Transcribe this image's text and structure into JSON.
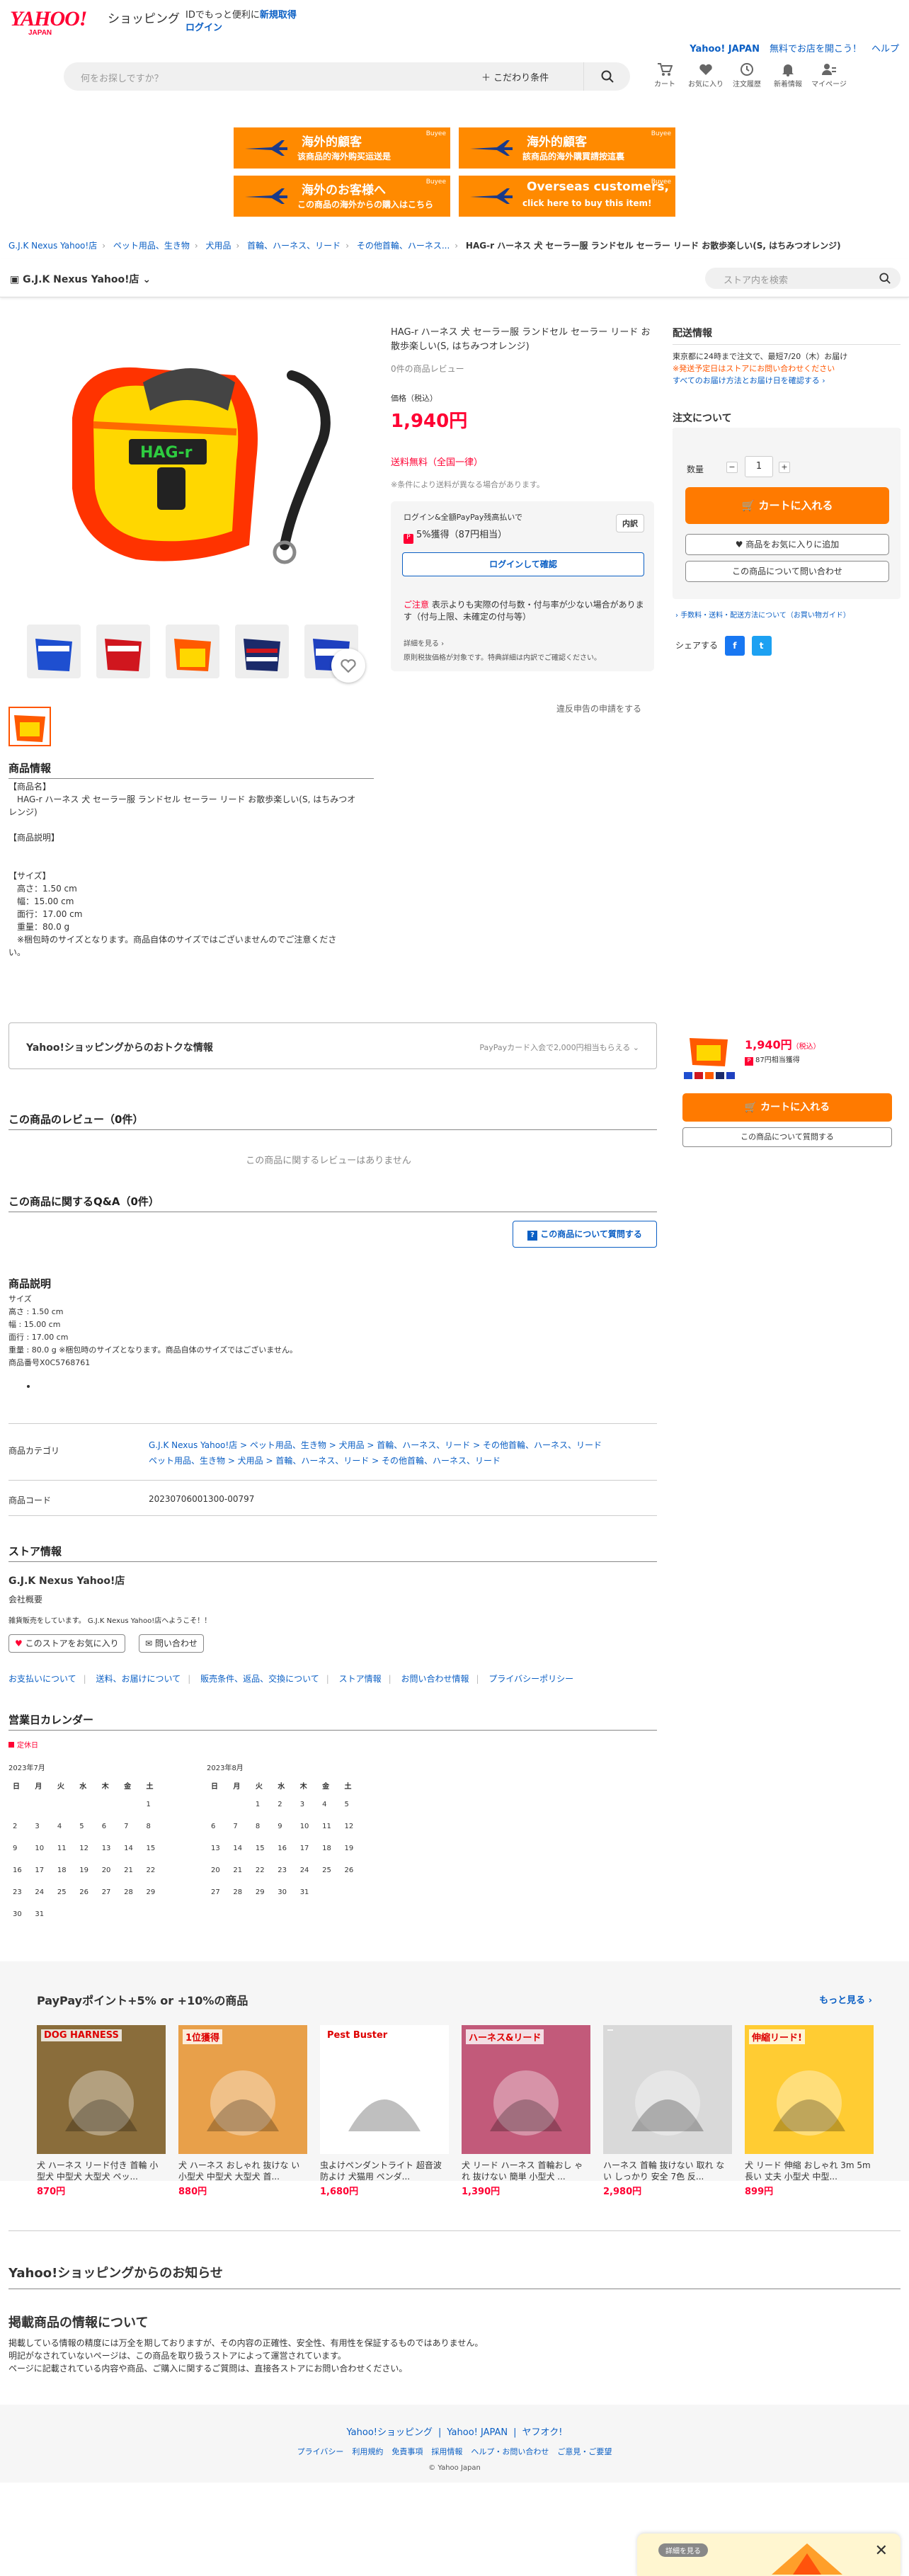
{
  "header": {
    "brand_yahoo": "YAHOO!",
    "brand_japan": "JAPAN",
    "brand_shop": "ショッピング",
    "id_note": "IDでもっと便利に",
    "register": "新規取得",
    "login": "ログイン",
    "link_yj": "Yahoo! JAPAN",
    "link_help1": "無料でお店を開こう！",
    "link_help2": "ヘルプ",
    "search_placeholder": "何をお探しですか？",
    "search_cond": "こだわり条件",
    "icons": [
      {
        "name": "cart-icon",
        "label": "カート"
      },
      {
        "name": "heart-icon",
        "label": "お気に入り"
      },
      {
        "name": "history-icon",
        "label": "注文履歴"
      },
      {
        "name": "bell-icon",
        "label": "新着情報"
      },
      {
        "name": "user-icon",
        "label": "マイページ"
      }
    ]
  },
  "banners": [
    {
      "t1": "海外的顧客",
      "t2": "该商品的海外购买运送是",
      "buyee": "Buyee",
      "color": "#ff8a00"
    },
    {
      "t1": "海外的顧客",
      "t2": "該商品的海外購買請按這裏",
      "buyee": "Buyee",
      "color": "#ff8a00"
    },
    {
      "t1": "海外のお客様へ",
      "t2": "この商品の海外からの購入はこちら",
      "buyee": "Buyee",
      "color": "#ff8a00"
    },
    {
      "t1": "Overseas customers,",
      "t2": "click here to buy this item!",
      "buyee": "Buyee",
      "color": "#ff8a00"
    }
  ],
  "breadcrumb": [
    "G.J.K Nexus Yahoo!店",
    "ペット用品、生き物",
    "犬用品",
    "首輪、ハーネス、リード",
    "その他首輪、ハーネス...",
    "HAG-r ハーネス 犬 セーラー服 ランドセル セーラー リード お散歩楽しい(S, はちみつオレンジ)"
  ],
  "store": {
    "name": "G.J.K Nexus Yahoo!店",
    "search_placeholder": "ストア内を検索"
  },
  "product": {
    "title": "HAG-r ハーネス 犬 セーラー服 ランドセル セーラー リード お散歩楽しい(S, はちみつオレンジ)",
    "reviews": "0件の商品レビュー",
    "price_label": "価格（税込）",
    "price": "1,940円",
    "shipping": "送料無料（全国一律）",
    "ship_note": "※条件により送料が異なる場合があります。",
    "pay_l1": "ログイン&全額PayPay残高払いで",
    "pay_pct": "5%獲得",
    "pay_pts": "（87円相当）",
    "pay_detail_btn": "内訳",
    "login_btn": "ログインして確認",
    "warn_title": "ご注意",
    "warn_text": "表示よりも実際の付与数・付与率が少ない場合があります（付与上限、未確定の付与等）",
    "details_link": "詳細を見る",
    "tax_note": "原則税抜価格が対象です。特典詳細は内訳でご確認ください。",
    "report": "違反申告の申請をする",
    "logo_text": "HAG-r"
  },
  "delivery": {
    "title": "配送情報",
    "line1": "東京都に24時まで注文で、最短7/20（木）お届け",
    "line2": "※発送予定日はストアにお問い合わせください",
    "link": "すべてのお届け方法とお届け日を確認する"
  },
  "order": {
    "title": "注文について",
    "qty_label": "数量",
    "qty": "1",
    "cart": "カートに入れる",
    "fav": "商品をお気に入りに追加",
    "ask": "この商品について問い合わせ",
    "guide": "手数料・送料・配送方法について（お買い物ガイド）",
    "share": "シェアする",
    "fb": "f",
    "tw": "t"
  },
  "float": {
    "price": "1,940円",
    "tax": "（税込）",
    "pts": "87円相当獲得",
    "cart": "カートに入れる",
    "ask": "この商品について質問する"
  },
  "info": {
    "title": "商品情報",
    "lines": [
      "【商品名】",
      "　HAG-r ハーネス 犬 セーラー服 ランドセル セーラー リード お散歩楽しい(S, はちみつオ",
      "レンジ)",
      "",
      "【商品説明】",
      "",
      "",
      "【サイズ】",
      "　高さ：1.50 cm",
      "　幅：15.00 cm",
      "　面行：17.00 cm",
      "　重量：80.0 g",
      "　※梱包時のサイズとなります。商品自体のサイズではございませんのでご注意くださ",
      "い。"
    ]
  },
  "deal": {
    "title": "Yahoo!ショッピングからのおトクな情報",
    "right": "PayPayカード入会で2,000円相当もらえる"
  },
  "reviews": {
    "title": "この商品のレビュー（0件）",
    "empty": "この商品に関するレビューはありません"
  },
  "qa": {
    "title": "この商品に関するQ&A（0件）",
    "btn": "この商品について質問する"
  },
  "desc": {
    "title": "商品説明",
    "lines": [
      "サイズ",
      "高さ : 1.50 cm",
      "幅 : 15.00 cm",
      "面行 : 17.00 cm",
      "重量 : 80.0 g ※梱包時のサイズとなります。商品自体のサイズではございません。",
      "商品番号X0C5768761"
    ]
  },
  "category": {
    "label": "商品カテゴリ",
    "line1": "G.J.K Nexus Yahoo!店 > ペット用品、生き物 > 犬用品 > 首輪、ハーネス、リード > その他首輪、ハーネス、リード",
    "line2": "ペット用品、生き物 > 犬用品 > 首輪、ハーネス、リード > その他首輪、ハーネス、リード"
  },
  "code": {
    "label": "商品コード",
    "value": "20230706001300-00797"
  },
  "storeinfo": {
    "title": "ストア情報",
    "name": "G.J.K Nexus Yahoo!店",
    "overview": "会社概要",
    "welcome": "雑貨販売をしています。 G.J.K Nexus Yahoo!店へようこそ！！",
    "fav_btn": "このストアをお気に入り",
    "inq_btn": "問い合わせ",
    "links": [
      "お支払いについて",
      "送料、お届けについて",
      "販売条件、返品、交換について",
      "ストア情報",
      "お問い合わせ情報",
      "プライバシーポリシー"
    ]
  },
  "calendar": {
    "title": "営業日カレンダー",
    "holiday": "定休日",
    "week": [
      "日",
      "月",
      "火",
      "水",
      "木",
      "金",
      "土"
    ],
    "months": [
      {
        "title": "2023年7月",
        "rows": [
          [
            "",
            "",
            "",
            "",
            "",
            "",
            "1"
          ],
          [
            "2",
            "3",
            "4",
            "5",
            "6",
            "7",
            "8"
          ],
          [
            "9",
            "10",
            "11",
            "12",
            "13",
            "14",
            "15"
          ],
          [
            "16",
            "17",
            "18",
            "19",
            "20",
            "21",
            "22"
          ],
          [
            "23",
            "24",
            "25",
            "26",
            "27",
            "28",
            "29"
          ],
          [
            "30",
            "31",
            "",
            "",
            "",
            "",
            ""
          ]
        ]
      },
      {
        "title": "2023年8月",
        "rows": [
          [
            "",
            "",
            "1",
            "2",
            "3",
            "4",
            "5"
          ],
          [
            "6",
            "7",
            "8",
            "9",
            "10",
            "11",
            "12"
          ],
          [
            "13",
            "14",
            "15",
            "16",
            "17",
            "18",
            "19"
          ],
          [
            "20",
            "21",
            "22",
            "23",
            "24",
            "25",
            "26"
          ],
          [
            "27",
            "28",
            "29",
            "30",
            "31",
            "",
            ""
          ]
        ]
      }
    ]
  },
  "reco": {
    "title": "PayPayポイント+5% or +10%の商品",
    "more": "もっと見る",
    "items": [
      {
        "name": "犬 ハーネス リード付き 首輪 小型犬 中型犬 大型犬 ペッ...",
        "price": "870円",
        "caption": "DOG HARNESS",
        "color": "#8a6d3b"
      },
      {
        "name": "犬 ハーネス おしゃれ 抜けな い 小型犬 中型犬 大型犬 首...",
        "price": "880円",
        "caption": "1位獲得",
        "color": "#e8a04a"
      },
      {
        "name": "虫よけペンダントライト 超音波 防よけ 犬猫用 ペンダ...",
        "price": "1,680円",
        "caption": "Pest Buster",
        "color": "#ffffff"
      },
      {
        "name": "犬 リード ハーネス 首輪おし ゃれ 抜けない 簡単 小型犬 ...",
        "price": "1,390円",
        "caption": "ハーネス&リード",
        "color": "#c25a7a"
      },
      {
        "name": "ハーネス 首輪 抜けない 取れ ない しっかり 安全 7色 反...",
        "price": "2,980円",
        "caption": "",
        "color": "#d9d9d9"
      },
      {
        "name": "犬 リード 伸縮 おしゃれ 3m 5m 長い 丈夫 小型犬 中型...",
        "price": "899円",
        "caption": "伸縮リード!",
        "color": "#ffcc33"
      }
    ]
  },
  "notice": {
    "title": "Yahoo!ショッピングからのお知らせ"
  },
  "disclaimer": {
    "title": "掲載商品の情報について",
    "lines": [
      "掲載している情報の精度には万全を期しておりますが、その内容の正確性、安全性、有用性を保証するものではありません。",
      "明記がなされていないページは、この商品を取り扱うストアによって運営されています。",
      "ページに記載されている内容や商品、ご購入に関するご質問は、直接各ストアにお問い合わせください。"
    ]
  },
  "footer": {
    "r1": [
      "Yahoo!ショッピング",
      "Yahoo! JAPAN",
      "ヤフオク!"
    ],
    "r2": [
      "プライバシー",
      "利用規約",
      "免責事項",
      "採用情報",
      "ヘルプ・お問い合わせ",
      "ご意見・ご要望"
    ],
    "copy": "© Yahoo Japan"
  },
  "promo": {
    "label": "詳細を見る"
  }
}
